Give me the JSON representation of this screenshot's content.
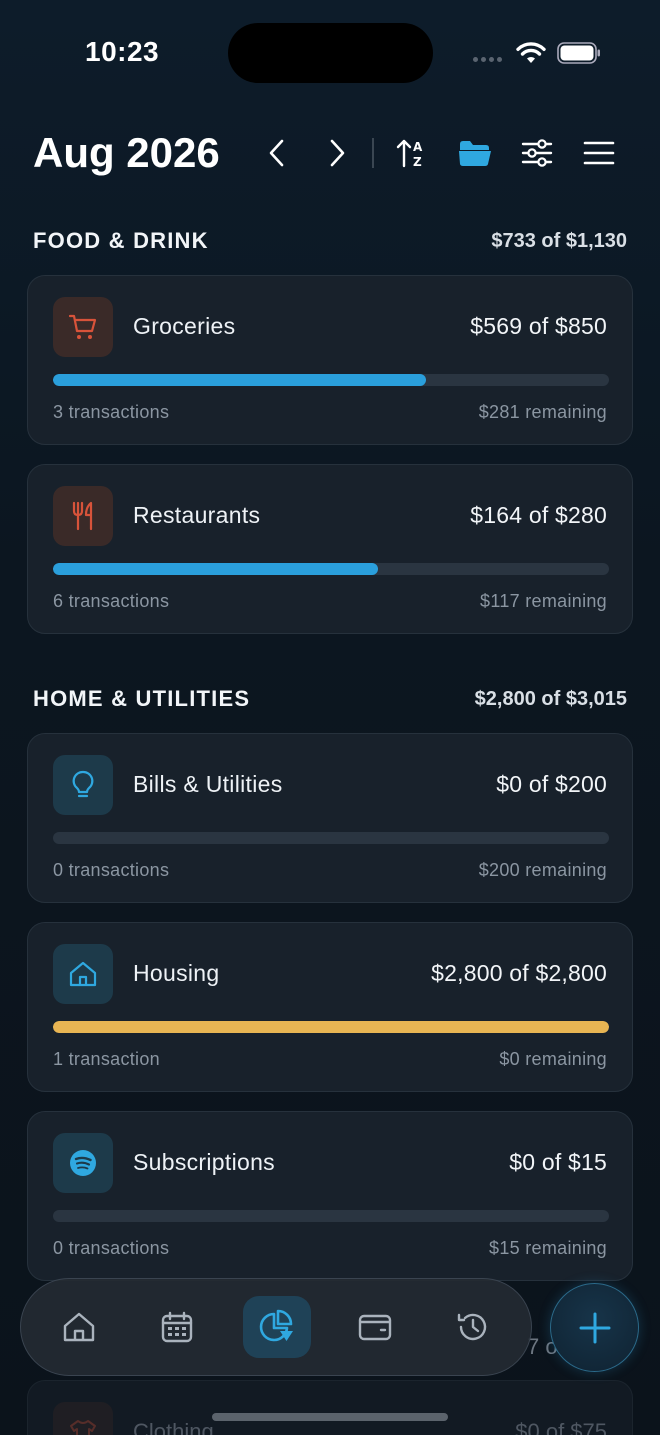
{
  "status_bar": {
    "time": "10:23"
  },
  "header": {
    "month": "Aug 2026"
  },
  "sections": [
    {
      "title": "FOOD & DRINK",
      "total": "$733 of $1,130",
      "categories": [
        {
          "name": "Groceries",
          "amount": "$569 of $850",
          "transactions": "3 transactions",
          "remaining": "$281 remaining",
          "progress": 0.67,
          "bar_color": "#2a9fdc",
          "icon": "cart-icon"
        },
        {
          "name": "Restaurants",
          "amount": "$164 of $280",
          "transactions": "6 transactions",
          "remaining": "$117 remaining",
          "progress": 0.585,
          "bar_color": "#2a9fdc",
          "icon": "fork-knife-icon"
        }
      ]
    },
    {
      "title": "HOME & UTILITIES",
      "total": "$2,800 of $3,015",
      "categories": [
        {
          "name": "Bills & Utilities",
          "amount": "$0 of $200",
          "transactions": "0 transactions",
          "remaining": "$200 remaining",
          "progress": 0,
          "bar_color": "#2a9fdc",
          "icon": "lightbulb-icon"
        },
        {
          "name": "Housing",
          "amount": "$2,800 of $2,800",
          "transactions": "1 transaction",
          "remaining": "$0 remaining",
          "progress": 1.0,
          "bar_color": "#e8b553",
          "icon": "house-icon"
        },
        {
          "name": "Subscriptions",
          "amount": "$0 of $15",
          "transactions": "0 transactions",
          "remaining": "$15 remaining",
          "progress": 0,
          "bar_color": "#2a9fdc",
          "icon": "spotify-icon"
        }
      ]
    }
  ],
  "peek": {
    "name": "Clothing",
    "amount": "$0 of $75",
    "behind_text": "7 o"
  },
  "colors": {
    "accent": "#2a9fdc",
    "warm_icon": "#d8533a",
    "cool_icon": "#2fa8e0",
    "full_bar": "#e8b553"
  }
}
